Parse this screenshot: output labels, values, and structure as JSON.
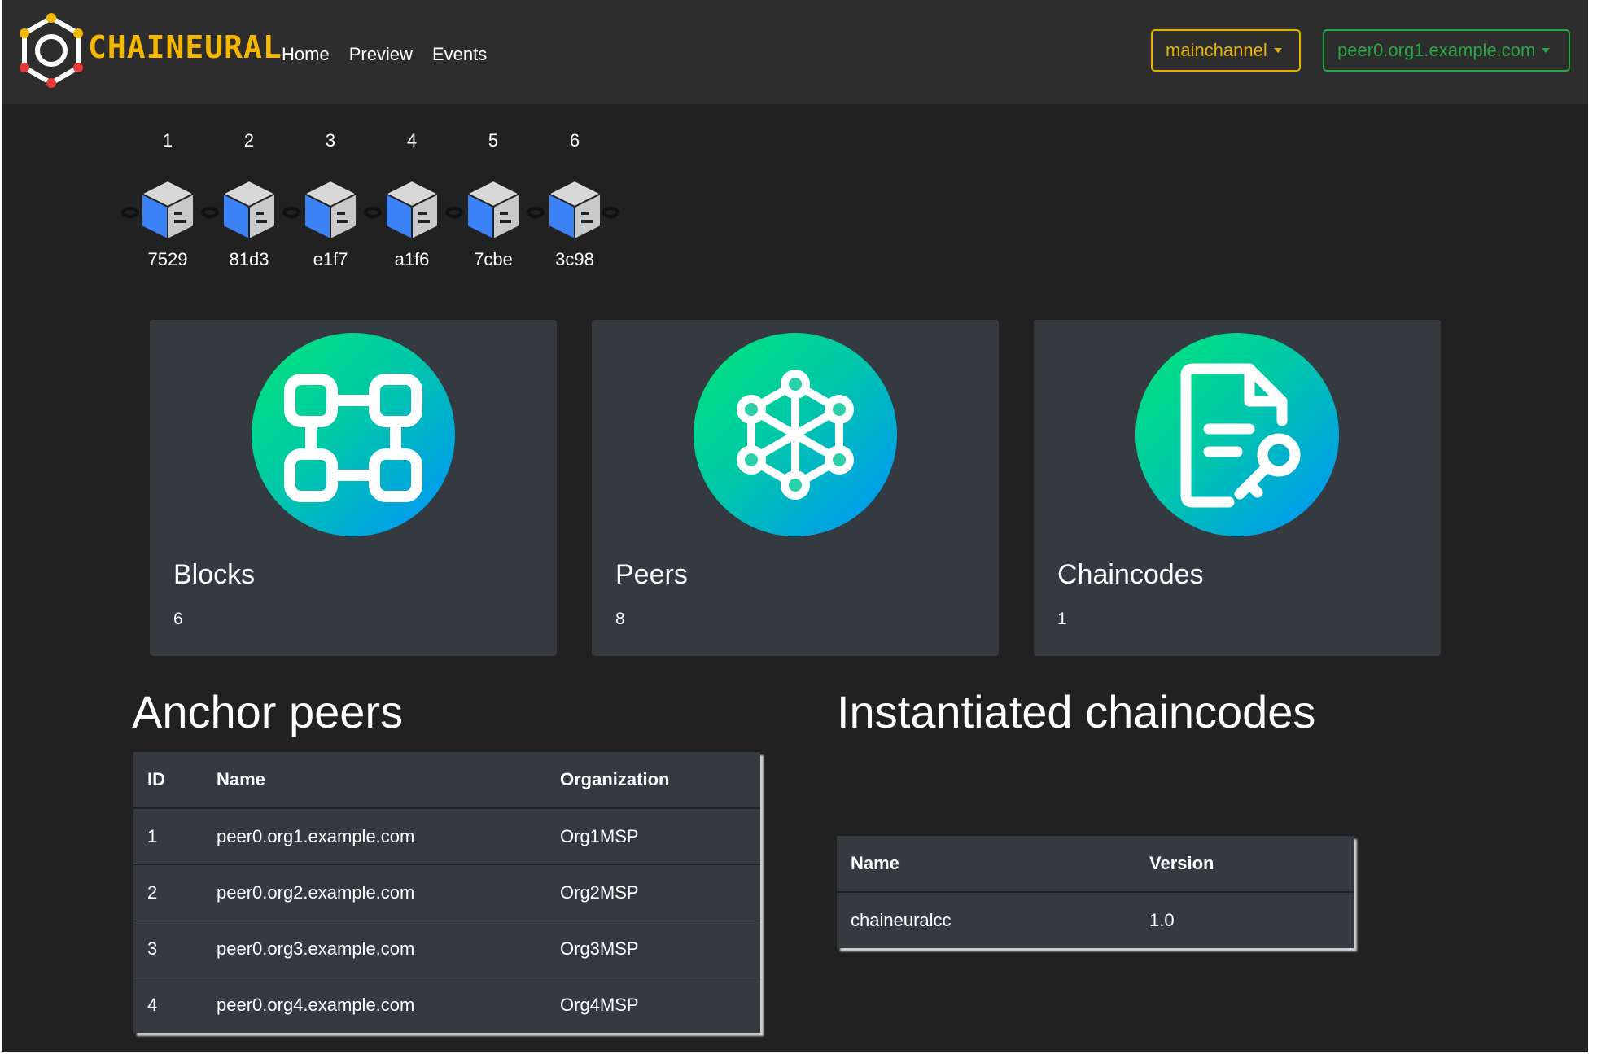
{
  "brand": {
    "name": "CHAINEURAL",
    "accent": "#f5b800"
  },
  "nav": {
    "links": [
      "Home",
      "Preview",
      "Events"
    ]
  },
  "channel_select": {
    "value": "mainchannel",
    "color": "#e6b400"
  },
  "peer_select": {
    "value": "peer0.org1.example.com",
    "color": "#28a745"
  },
  "blocks": [
    {
      "num": "1",
      "hash": "7529"
    },
    {
      "num": "2",
      "hash": "81d3"
    },
    {
      "num": "3",
      "hash": "e1f7"
    },
    {
      "num": "4",
      "hash": "a1f6"
    },
    {
      "num": "5",
      "hash": "7cbe"
    },
    {
      "num": "6",
      "hash": "3c98"
    }
  ],
  "stats": [
    {
      "title": "Blocks",
      "count": "6",
      "icon": "blocks-icon"
    },
    {
      "title": "Peers",
      "count": "8",
      "icon": "peers-network-icon"
    },
    {
      "title": "Chaincodes",
      "count": "1",
      "icon": "chaincode-document-key-icon"
    }
  ],
  "anchor_peers": {
    "title": "Anchor peers",
    "headers": [
      "ID",
      "Name",
      "Organization"
    ],
    "rows": [
      [
        "1",
        "peer0.org1.example.com",
        "Org1MSP"
      ],
      [
        "2",
        "peer0.org2.example.com",
        "Org2MSP"
      ],
      [
        "3",
        "peer0.org3.example.com",
        "Org3MSP"
      ],
      [
        "4",
        "peer0.org4.example.com",
        "Org4MSP"
      ]
    ]
  },
  "chaincodes": {
    "title": "Instantiated chaincodes",
    "headers": [
      "Name",
      "Version"
    ],
    "rows": [
      [
        "chaineuralcc",
        "1.0"
      ]
    ]
  }
}
